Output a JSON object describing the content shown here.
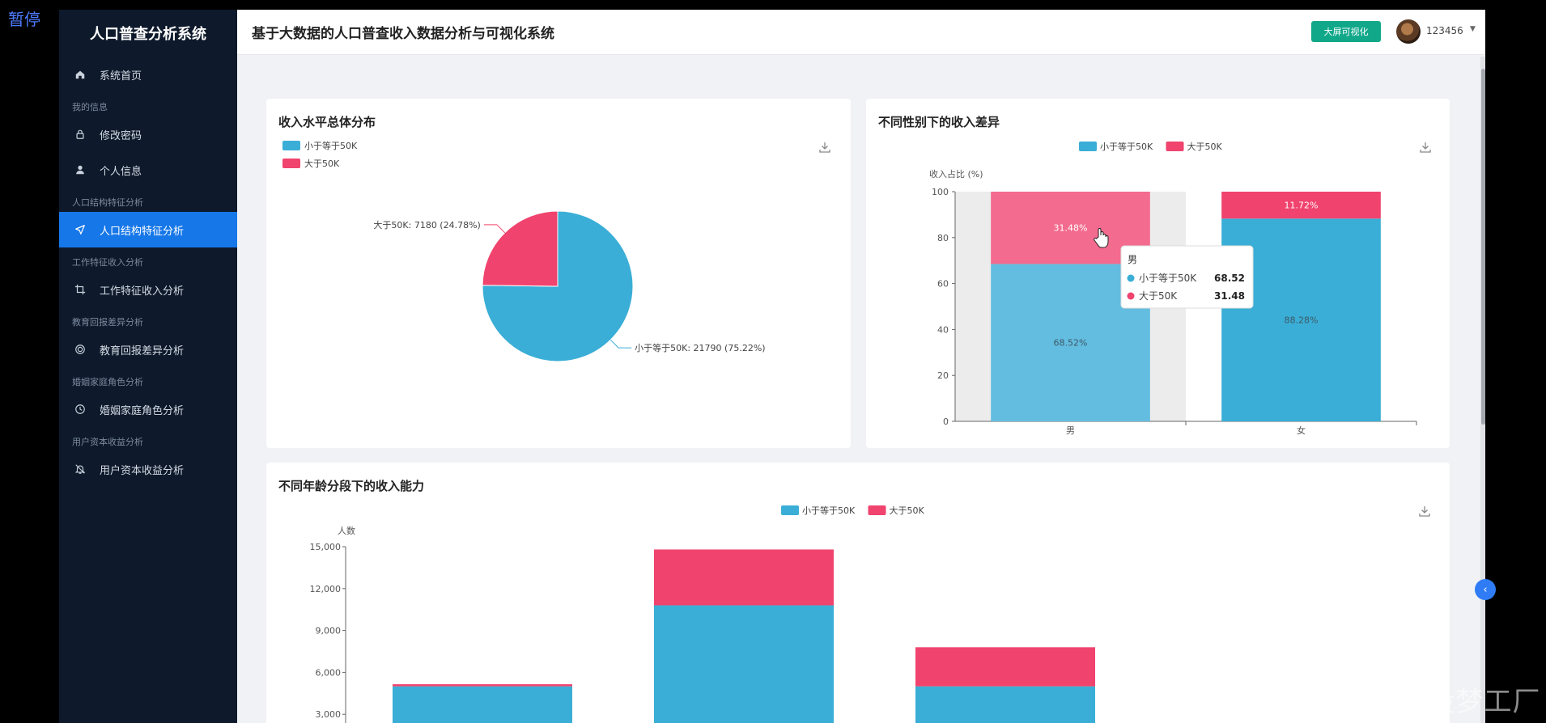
{
  "overlay": {
    "pause_label": "暂停",
    "watermark": "CSDN @IT毕设梦工厂"
  },
  "sidebar": {
    "brand": "人口普查分析系统",
    "items": [
      {
        "type": "item",
        "label": "系统首页",
        "icon": "home-icon"
      },
      {
        "type": "section",
        "label": "我的信息"
      },
      {
        "type": "item",
        "label": "修改密码",
        "icon": "lock-icon"
      },
      {
        "type": "item",
        "label": "个人信息",
        "icon": "user-icon"
      },
      {
        "type": "section",
        "label": "人口结构特征分析"
      },
      {
        "type": "item",
        "label": "人口结构特征分析",
        "icon": "navigation-icon",
        "active": true
      },
      {
        "type": "section",
        "label": "工作特征收入分析"
      },
      {
        "type": "item",
        "label": "工作特征收入分析",
        "icon": "crop-icon"
      },
      {
        "type": "section",
        "label": "教育回报差异分析"
      },
      {
        "type": "item",
        "label": "教育回报差异分析",
        "icon": "target-icon"
      },
      {
        "type": "section",
        "label": "婚姻家庭角色分析"
      },
      {
        "type": "item",
        "label": "婚姻家庭角色分析",
        "icon": "clock-icon"
      },
      {
        "type": "section",
        "label": "用户资本收益分析"
      },
      {
        "type": "item",
        "label": "用户资本收益分析",
        "icon": "bell-off-icon"
      }
    ]
  },
  "topbar": {
    "title": "基于大数据的人口普查收入数据分析与可视化系统",
    "bigscreen_label": "大屏可视化",
    "username": "123456"
  },
  "colors": {
    "blue": "#3aaed6",
    "red": "#f0436e",
    "accent": "#1677e8",
    "green": "#11a88a"
  },
  "chart_data": [
    {
      "type": "pie",
      "title": "收入水平总体分布",
      "legend": [
        "小于等于50K",
        "大于50K"
      ],
      "slices": [
        {
          "name": "小于等于50K",
          "value": 21790,
          "percent": 75.22,
          "label": "小于等于50K: 21790 (75.22%)"
        },
        {
          "name": "大于50K",
          "value": 7180,
          "percent": 24.78,
          "label": "大于50K: 7180 (24.78%)"
        }
      ]
    },
    {
      "type": "bar",
      "stacked": true,
      "title": "不同性别下的收入差异",
      "ylabel": "收入占比 (%)",
      "ylim": [
        0,
        100
      ],
      "yticks": [
        "0",
        "20",
        "40",
        "60",
        "80",
        "100"
      ],
      "categories": [
        "男",
        "女"
      ],
      "series": [
        {
          "name": "小于等于50K",
          "values": [
            68.52,
            88.28
          ],
          "labels": [
            "68.52%",
            "88.28%"
          ]
        },
        {
          "name": "大于50K",
          "values": [
            31.48,
            11.72
          ],
          "labels": [
            "31.48%",
            "11.72%"
          ]
        }
      ],
      "tooltip": {
        "title": "男",
        "rows": [
          {
            "name": "小于等于50K",
            "value": "68.52"
          },
          {
            "name": "大于50K",
            "value": "31.48"
          }
        ]
      }
    },
    {
      "type": "bar",
      "stacked": true,
      "title": "不同年龄分段下的收入能力",
      "ylabel": "人数",
      "ylim": [
        0,
        15000
      ],
      "yticks": [
        "3,000",
        "6,000",
        "9,000",
        "12,000",
        "15,000"
      ],
      "series": [
        {
          "name": "小于等于50K",
          "values": [
            5000,
            10800,
            5000
          ]
        },
        {
          "name": "大于50K",
          "values": [
            150,
            4000,
            2800
          ]
        }
      ]
    }
  ]
}
